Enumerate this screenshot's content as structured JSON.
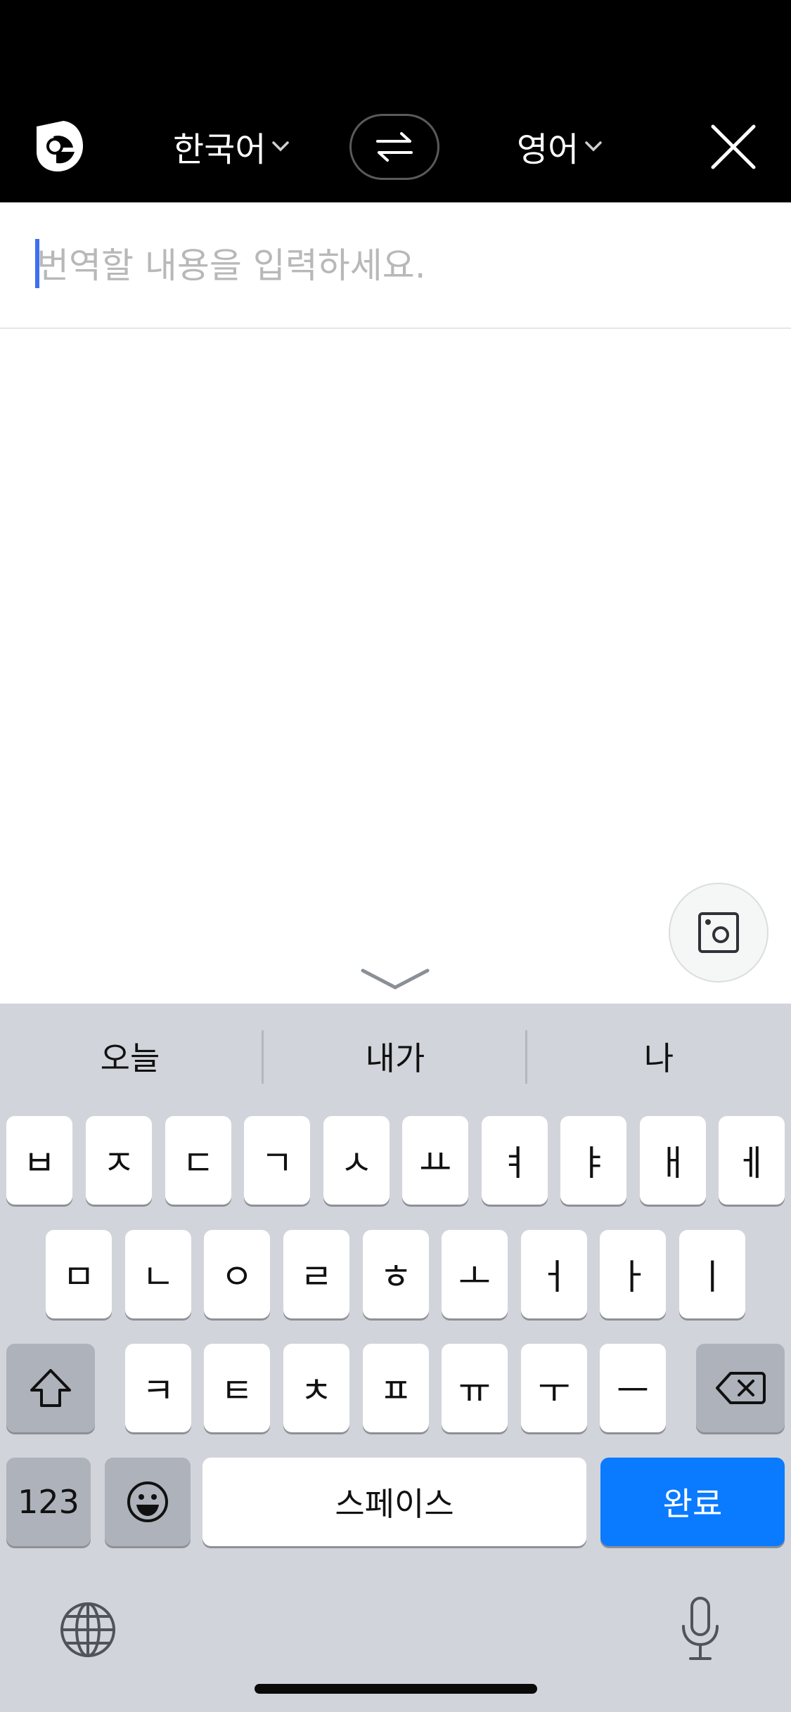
{
  "header": {
    "logo_icon": "papago-logo-icon",
    "source_lang": "한국어",
    "target_lang": "영어",
    "swap_icon": "swap-arrows-icon",
    "close_icon": "close-icon"
  },
  "input": {
    "placeholder": "번역할 내용을 입력하세요."
  },
  "actions": {
    "photo_icon": "camera-photo-icon",
    "collapse_icon": "chevron-down-icon"
  },
  "keyboard": {
    "suggestions": [
      "오늘",
      "내가",
      "나"
    ],
    "row1": [
      "ㅂ",
      "ㅈ",
      "ㄷ",
      "ㄱ",
      "ㅅ",
      "ㅛ",
      "ㅕ",
      "ㅑ",
      "ㅐ",
      "ㅔ"
    ],
    "row2": [
      "ㅁ",
      "ㄴ",
      "ㅇ",
      "ㄹ",
      "ㅎ",
      "ㅗ",
      "ㅓ",
      "ㅏ",
      "ㅣ"
    ],
    "row3": [
      "ㅋ",
      "ㅌ",
      "ㅊ",
      "ㅍ",
      "ㅠ",
      "ㅜ",
      "ㅡ"
    ],
    "numbers_label": "123",
    "space_label": "스페이스",
    "done_label": "완료",
    "shift_icon": "shift-icon",
    "delete_icon": "backspace-icon",
    "emoji_icon": "emoji-icon",
    "globe_icon": "globe-icon",
    "mic_icon": "microphone-icon"
  },
  "colors": {
    "accent_blue": "#0a7aff",
    "caret_blue": "#3f6ef0",
    "header_bg": "#000000",
    "keyboard_bg": "#d1d4da"
  }
}
